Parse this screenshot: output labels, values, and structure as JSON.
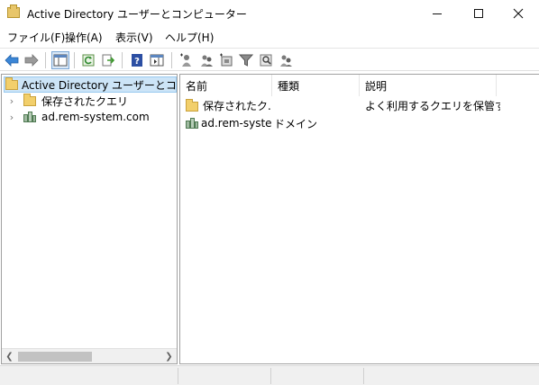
{
  "window": {
    "title": "Active Directory ユーザーとコンピューター",
    "icon": "folder-app-icon"
  },
  "menu": [
    "ファイル(F)",
    "操作(A)",
    "表示(V)",
    "ヘルプ(H)"
  ],
  "toolbar": {
    "buttons": [
      "back-arrow-icon",
      "forward-arrow-icon",
      "console-tree-icon",
      "refresh-icon",
      "export-list-icon",
      "help-icon",
      "show-hide-action-pane-icon",
      "add-user-icon",
      "add-group-icon",
      "add-ou-icon",
      "filter-icon",
      "find-icon",
      "add-to-group-icon"
    ]
  },
  "tree": {
    "root_label": "Active Directory ユーザーとコンピュー",
    "items": [
      {
        "label": "保存されたクエリ",
        "icon": "folder-icon"
      },
      {
        "label": "ad.rem-system.com",
        "icon": "domain-icon"
      }
    ]
  },
  "list": {
    "columns": [
      "名前",
      "種類",
      "説明"
    ],
    "rows": [
      {
        "name": "保存されたク...",
        "type": "",
        "description": "よく利用するクエリを保管す...",
        "icon": "folder-icon"
      },
      {
        "name": "ad.rem-syste...",
        "type": "ドメイン",
        "description": "",
        "icon": "domain-icon"
      }
    ]
  },
  "colors": {
    "selection": "#cce4f7",
    "selection_border": "#99c9ef",
    "folder": "#f2cf6b"
  }
}
